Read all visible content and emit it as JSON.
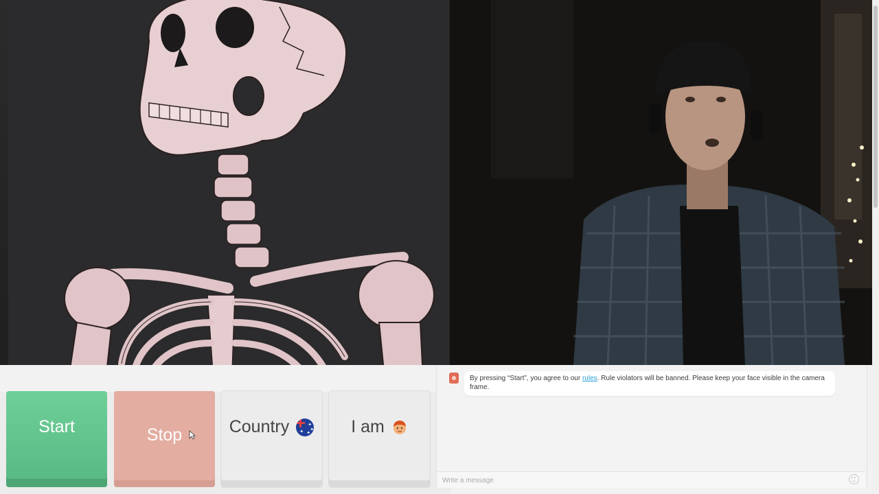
{
  "controls": {
    "start_label": "Start",
    "stop_label": "Stop",
    "country_label": "Country",
    "country_flag_icon": "australia-flag-icon",
    "iam_label": "I am",
    "iam_icon": "boy-face-icon"
  },
  "chat": {
    "system_message_pre": "By pressing “Start”, you agree to our ",
    "rules_link": "rules",
    "system_message_post": ". Rule violators will be banned. Please keep your face visible in the camera frame.",
    "input_placeholder": "Write a message",
    "emoji_icon": "smiley-icon"
  },
  "colors": {
    "start": "#6fcf97",
    "stop": "#e4a79a",
    "link": "#2a9fd6"
  }
}
